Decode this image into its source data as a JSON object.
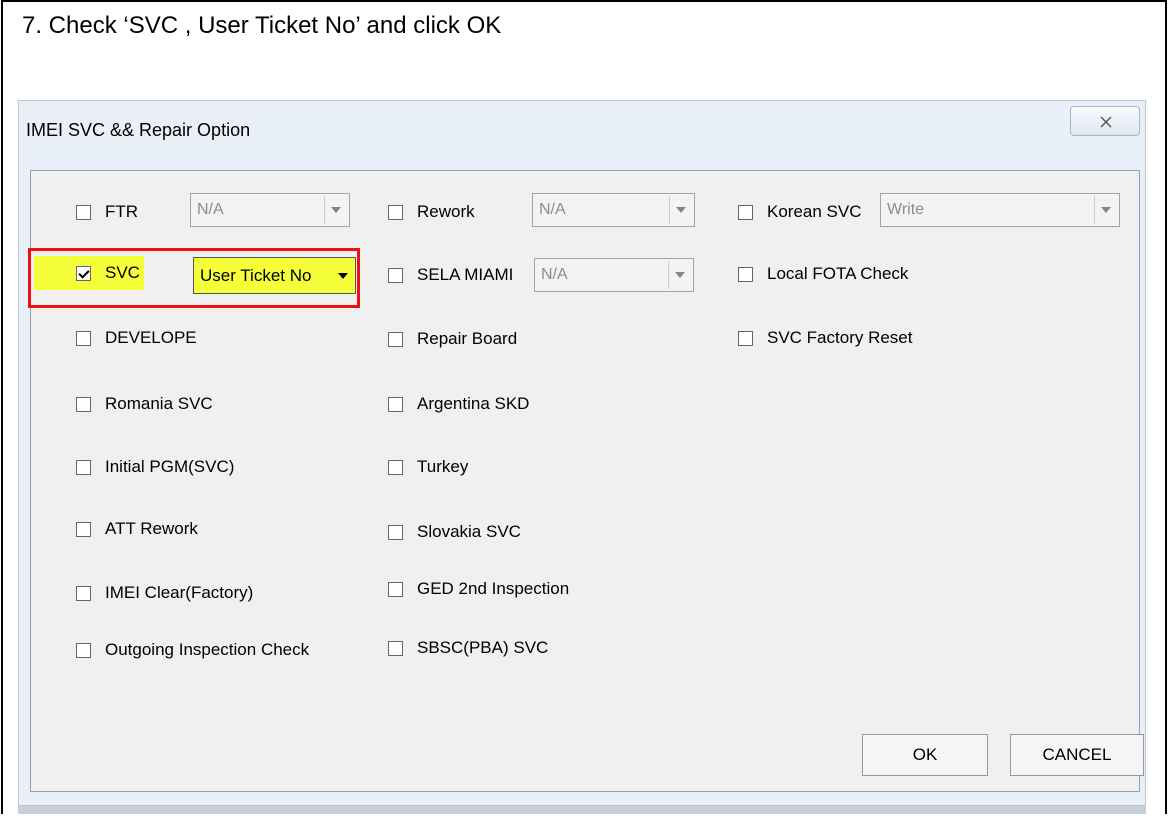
{
  "instruction": "7. Check ‘SVC , User Ticket No’ and click OK",
  "dialog": {
    "title": "IMEI SVC && Repair Option",
    "close_icon": "close-icon"
  },
  "options": {
    "col1": [
      {
        "label": "FTR",
        "checked": false
      },
      {
        "label": "SVC",
        "checked": true
      },
      {
        "label": "DEVELOPE",
        "checked": false
      },
      {
        "label": "Romania SVC",
        "checked": false
      },
      {
        "label": "Initial PGM(SVC)",
        "checked": false
      },
      {
        "label": "ATT Rework",
        "checked": false
      },
      {
        "label": "IMEI Clear(Factory)",
        "checked": false
      },
      {
        "label": "Outgoing Inspection Check",
        "checked": false
      }
    ],
    "col2": [
      {
        "label": "Rework",
        "checked": false
      },
      {
        "label": "SELA MIAMI",
        "checked": false
      },
      {
        "label": "Repair Board",
        "checked": false
      },
      {
        "label": "Argentina SKD",
        "checked": false
      },
      {
        "label": "Turkey",
        "checked": false
      },
      {
        "label": "Slovakia SVC",
        "checked": false
      },
      {
        "label": "GED 2nd Inspection",
        "checked": false
      },
      {
        "label": "SBSC(PBA) SVC",
        "checked": false
      }
    ],
    "col3": [
      {
        "label": "Korean SVC",
        "checked": false
      },
      {
        "label": "Local FOTA Check",
        "checked": false
      },
      {
        "label": "SVC Factory Reset",
        "checked": false
      }
    ]
  },
  "combos": {
    "ftr": "N/A",
    "svc": "User Ticket No",
    "rework": "N/A",
    "sela_miami": "N/A",
    "korean_svc": "Write"
  },
  "buttons": {
    "ok": "OK",
    "cancel": "CANCEL"
  },
  "colors": {
    "highlight": "#f4ff3a",
    "annotation_box": "#ee1111"
  }
}
